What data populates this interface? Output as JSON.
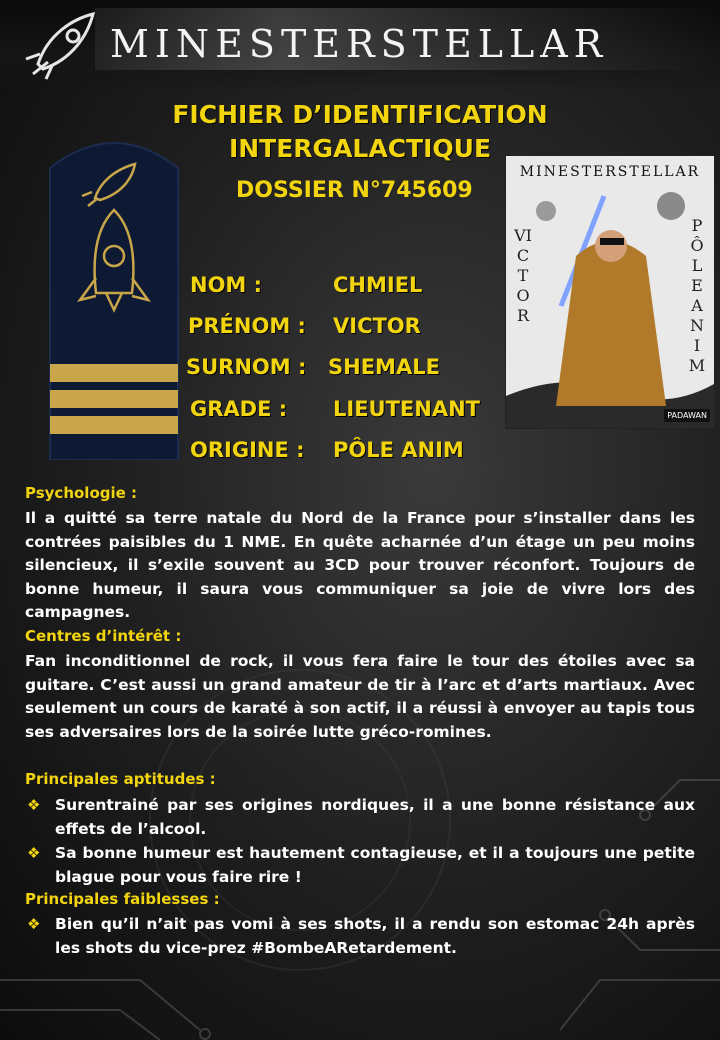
{
  "header": {
    "brand": "MINESTERSTELLAR"
  },
  "document": {
    "title_line1": "FICHIER D’IDENTIFICATION",
    "title_line2": "INTERGALACTIQUE",
    "dossier": "DOSSIER N°745609"
  },
  "fields": [
    {
      "label": "NOM :",
      "value": "CHMIEL"
    },
    {
      "label": "PRÉNOM :",
      "value": "VICTOR"
    },
    {
      "label": "SURNOM :",
      "value": "SHEMALE"
    },
    {
      "label": "GRADE :",
      "value": "LIEUTENANT"
    },
    {
      "label": "ORIGINE :",
      "value": "PÔLE ANIM"
    }
  ],
  "photo": {
    "title": "MINESTERSTELLAR",
    "left_text": "VICTOR",
    "right_text": "PÔLE ANIM",
    "badge": "PADAWAN"
  },
  "sections": {
    "psychologie": {
      "title": "Psychologie :",
      "text": "Il a quitté sa terre natale du Nord de la France pour s’installer dans les contrées paisibles du 1 NME. En quête acharnée d’un étage un peu moins silencieux, il s’exile souvent au 3CD pour trouver réconfort. Toujours de bonne humeur, il saura vous communiquer sa joie de vivre lors des campagnes."
    },
    "interets": {
      "title": "Centres d’intérêt :",
      "text": "Fan inconditionnel de rock, il vous fera faire le tour des étoiles avec sa guitare. C’est aussi un grand amateur de tir à l’arc et d’arts martiaux. Avec seulement un cours de karaté à son actif, il a réussi à envoyer au tapis tous ses adversaires lors de la soirée lutte gréco-romines."
    },
    "aptitudes": {
      "title": "Principales aptitudes :",
      "items": [
        "Surentrainé par ses origines nordiques, il a une bonne résistance aux effets de l’alcool.",
        "Sa bonne humeur est hautement contagieuse, et il a toujours une petite blague pour vous faire rire !"
      ]
    },
    "faiblesses": {
      "title": "Principales faiblesses :",
      "items": [
        "Bien qu’il n’ait pas vomi à ses shots, il a rendu son estomac 24h après les shots du vice-prez #BombeARetardement."
      ]
    }
  },
  "colors": {
    "accent": "#f2d40f",
    "text": "#ffffff",
    "background": "#1e1e1e"
  },
  "icons": {
    "bullet": "diamond-bullet-icon",
    "epaulette": "rocket-icon",
    "logo": "rocket-logo-icon"
  }
}
